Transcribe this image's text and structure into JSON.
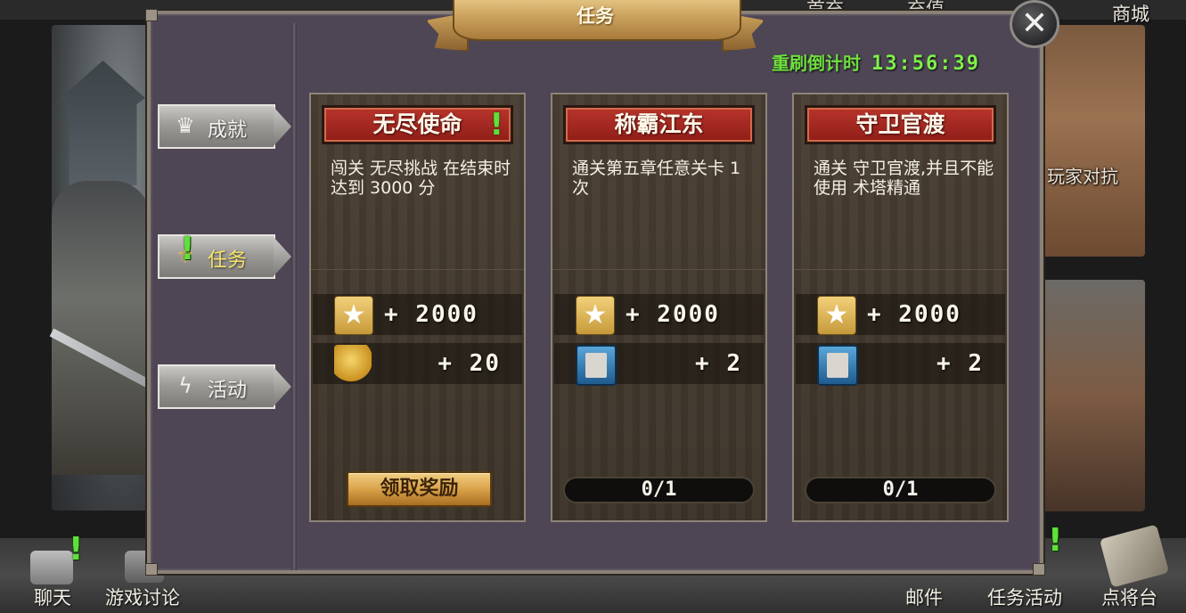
{
  "top_nav": {
    "partial_1": "首充",
    "partial_2": "充值",
    "shop_label": "商城"
  },
  "background_cards": {
    "pvp_label": "玩家对抗"
  },
  "bottom_nav": {
    "chat": "聊天",
    "forum": "游戏讨论",
    "mail": "邮件",
    "task_activity": "任务活动",
    "general_stage": "点将台"
  },
  "dialog": {
    "title": "任务",
    "refresh_label": "重刷倒计时",
    "refresh_time": "13:56:39",
    "close_symbol": "✕"
  },
  "tabs": [
    {
      "label": "成就",
      "icon": "crown-icon",
      "active": false
    },
    {
      "label": "任务",
      "icon": "scroll-icon",
      "active": true
    },
    {
      "label": "活动",
      "icon": "lightning-icon",
      "active": false
    }
  ],
  "quests": [
    {
      "title": "无尽使命",
      "alert": true,
      "description": "闯关 无尽挑战 在结束时达到 3000 分",
      "reward_1": "+ 2000",
      "reward_2": "+ 20",
      "reward_2_icon": "gold-coins-icon",
      "action_label": "领取奖励"
    },
    {
      "title": "称霸江东",
      "alert": false,
      "description": "通关第五章任意关卡 1 次",
      "reward_1": "+ 2000",
      "reward_2": "+ 2",
      "reward_2_icon": "card-pack-icon",
      "progress": "0/1"
    },
    {
      "title": "守卫官渡",
      "alert": false,
      "description": "通关 守卫官渡,并且不能使用 术塔精通",
      "reward_1": "+ 2000",
      "reward_2": "+ 2",
      "reward_2_icon": "card-pack-icon",
      "progress": "0/1"
    }
  ],
  "colors": {
    "dialog_bg": "#4e4655",
    "card_title_red": "#b8342c",
    "timer_green": "#7ff04b",
    "active_tab_text": "#f6e36a"
  }
}
